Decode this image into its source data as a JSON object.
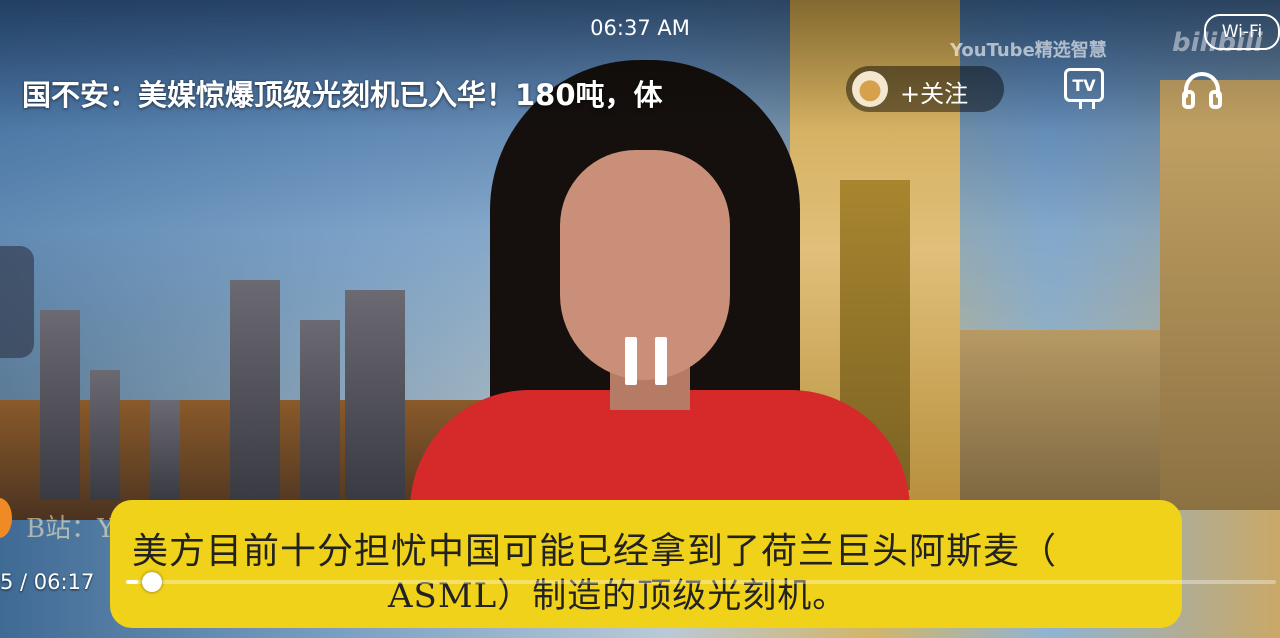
{
  "status_bar": {
    "time": "06:37 AM",
    "wifi_label": "Wi-Fi"
  },
  "watermark": {
    "text": "YouTube精选智慧",
    "logo_text": "bilibili"
  },
  "video": {
    "title": "国不安：美媒惊爆顶级光刻机已入华！180吨，体",
    "follow_label": "+关注",
    "tv_label": "TV",
    "state": "playing",
    "subtitle_line1": "美方目前十分担忧中国可能已经拿到了荷兰巨头阿斯麦（",
    "subtitle_line2": "ASML）制造的顶级光刻机。",
    "ghost_text": "B站：YouTube精选智慧·必读",
    "time_display": "5 / 06:17",
    "progress_fraction": 0.01
  },
  "icons": {
    "tv": "tv-cast-icon",
    "headset": "headphones-icon",
    "pause": "pause-icon",
    "avatar": "channel-avatar"
  },
  "colors": {
    "subtitle_bg": "#f0d21a",
    "orange_dot": "#f08a24",
    "dress": "#d62a2a"
  }
}
